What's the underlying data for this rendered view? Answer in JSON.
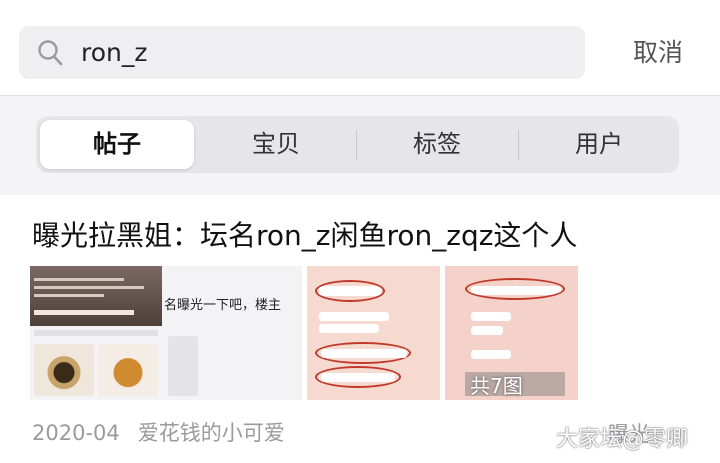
{
  "search": {
    "query": "ron_z",
    "cancel_label": "取消"
  },
  "tabs": [
    {
      "label": "帖子",
      "active": true
    },
    {
      "label": "宝贝",
      "active": false
    },
    {
      "label": "标签",
      "active": false
    },
    {
      "label": "用户",
      "active": false
    }
  ],
  "post": {
    "title": "曝光拉黑姐：坛名ron_z闲鱼ron_zqz这个人",
    "snippet": "名曝光一下吧，楼主",
    "image_count": "共7图",
    "date": "2020-04",
    "author": "爱花钱的小可爱",
    "views_label": "曝光"
  },
  "watermark": "大家坛@零卿",
  "colors": {
    "accent_red": "#c0392b",
    "meta_gray": "#9a9a9f"
  }
}
